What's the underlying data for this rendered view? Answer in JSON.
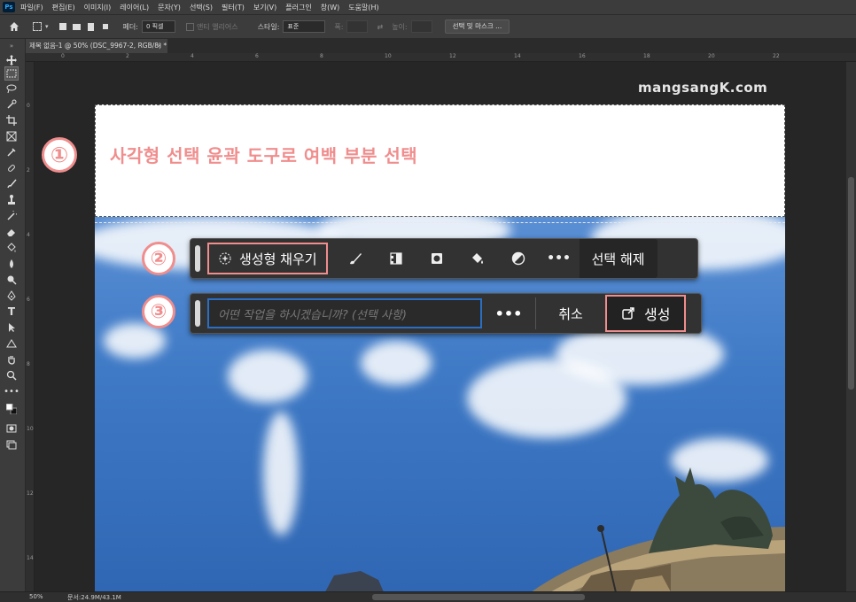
{
  "menubar": {
    "logo": "Ps",
    "items": [
      "파일(F)",
      "편집(E)",
      "이미지(I)",
      "레이어(L)",
      "문자(Y)",
      "선택(S)",
      "필터(T)",
      "보기(V)",
      "플러그인",
      "창(W)",
      "도움말(H)"
    ]
  },
  "options": {
    "feather_label": "페더:",
    "feather_value": "0 픽셀",
    "antialias_label": "앤티 앨리어스",
    "style_label": "스타일:",
    "style_value": "표준",
    "width_label": "폭:",
    "height_label": "높이:",
    "mask_button": "선택 및 마스크 ..."
  },
  "document_tab": {
    "title": "제목 없음-1 @ 50% (DSC_9967-2, RGB/8) *",
    "close": "×"
  },
  "ruler": {
    "h_ticks": [
      "0",
      "2",
      "4",
      "6",
      "8",
      "10",
      "12",
      "14",
      "16",
      "18",
      "20",
      "22"
    ],
    "v_ticks": [
      "0",
      "2",
      "4",
      "6",
      "8",
      "10",
      "12",
      "14",
      "16"
    ]
  },
  "overlay": {
    "watermark": "mangsangK.com",
    "step1": "①",
    "step2": "②",
    "step3": "③",
    "instruction": "사각형 선택 윤곽 도구로 여백 부분 선택"
  },
  "context_bar_1": {
    "generative_fill": "생성형 채우기",
    "more": "•••",
    "deselect": "선택 해제",
    "icons": [
      "brush-icon",
      "mask-icon",
      "mask-fill-icon",
      "paint-bucket-icon",
      "contrast-icon"
    ]
  },
  "context_bar_2": {
    "prompt_placeholder": "어떤 작업을 하시겠습니까? (선택 사항)",
    "more": "•••",
    "cancel": "취소",
    "generate": "생성"
  },
  "status": {
    "zoom": "50%",
    "doc_size": "문서:24.9M/43.1M"
  },
  "colors": {
    "accent_highlight": "#f08d8d",
    "prompt_border": "#2b6fc4",
    "panel_bg": "#3c3c3c"
  }
}
